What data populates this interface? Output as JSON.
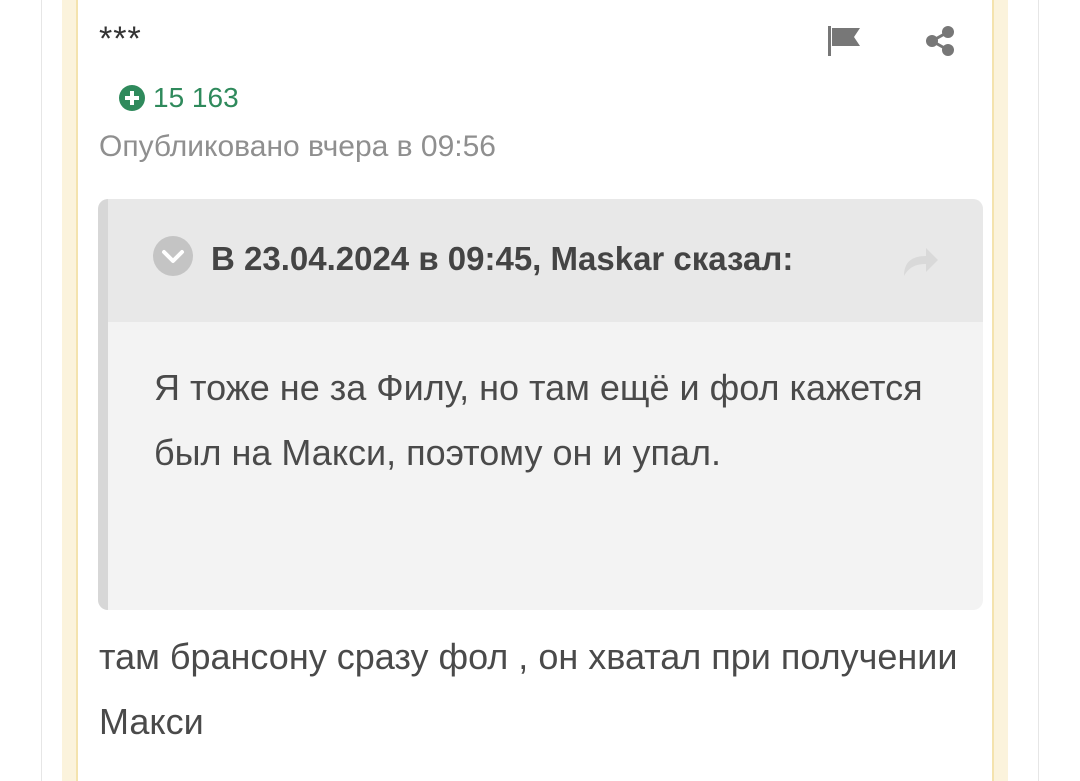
{
  "post": {
    "author": "***",
    "reputation_value": "15 163",
    "published": "Опубликовано вчера в 09:56",
    "quote": {
      "citation": "В 23.04.2024 в 09:45, Maskar сказал:",
      "text": "Я тоже не за Филу, но там ещё и фол кажется был на Макси, поэтому он и упал."
    },
    "body": "там брансону сразу фол , он хватал при получении Макси"
  },
  "icons": {
    "report": "flag-icon",
    "share": "share-icon",
    "reputation": "plus-circle-icon",
    "quote_toggle": "chevron-down-circle-icon",
    "quote_goto": "reply-arrow-icon"
  },
  "colors": {
    "reputation": "#2f8a5c",
    "card_border": "#fbf3dc",
    "quote_background": "#f3f3f3",
    "quote_header": "#e8e8e8"
  }
}
